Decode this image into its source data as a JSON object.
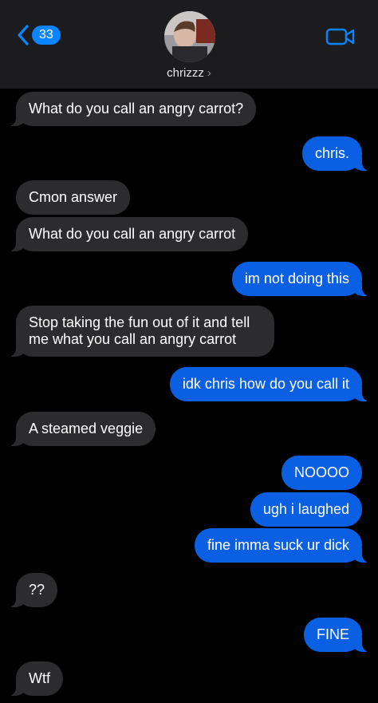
{
  "header": {
    "back_badge": "33",
    "contact_name": "chrizzz",
    "accent": "#0a84ff"
  },
  "messages": [
    {
      "from": "them",
      "text": "What do you call an angry carrot?"
    },
    {
      "from": "me",
      "text": "chris."
    },
    {
      "from": "them",
      "text": "Cmon answer"
    },
    {
      "from": "them",
      "text": "What do you call an angry carrot"
    },
    {
      "from": "me",
      "text": "im not doing this"
    },
    {
      "from": "them",
      "text": "Stop taking the fun out of it and tell me what you call an angry carrot"
    },
    {
      "from": "me",
      "text": "idk chris how do you call it"
    },
    {
      "from": "them",
      "text": "A steamed veggie"
    },
    {
      "from": "me",
      "text": "NOOOO"
    },
    {
      "from": "me",
      "text": "ugh i laughed"
    },
    {
      "from": "me",
      "text": "fine imma suck ur dick"
    },
    {
      "from": "them",
      "text": "??"
    },
    {
      "from": "me",
      "text": "FINE"
    },
    {
      "from": "them",
      "text": "Wtf"
    }
  ],
  "colors": {
    "incoming_bubble": "#2c2c2e",
    "outgoing_bubble": "#0b5fe3",
    "header_bg": "#1c1c1e"
  }
}
